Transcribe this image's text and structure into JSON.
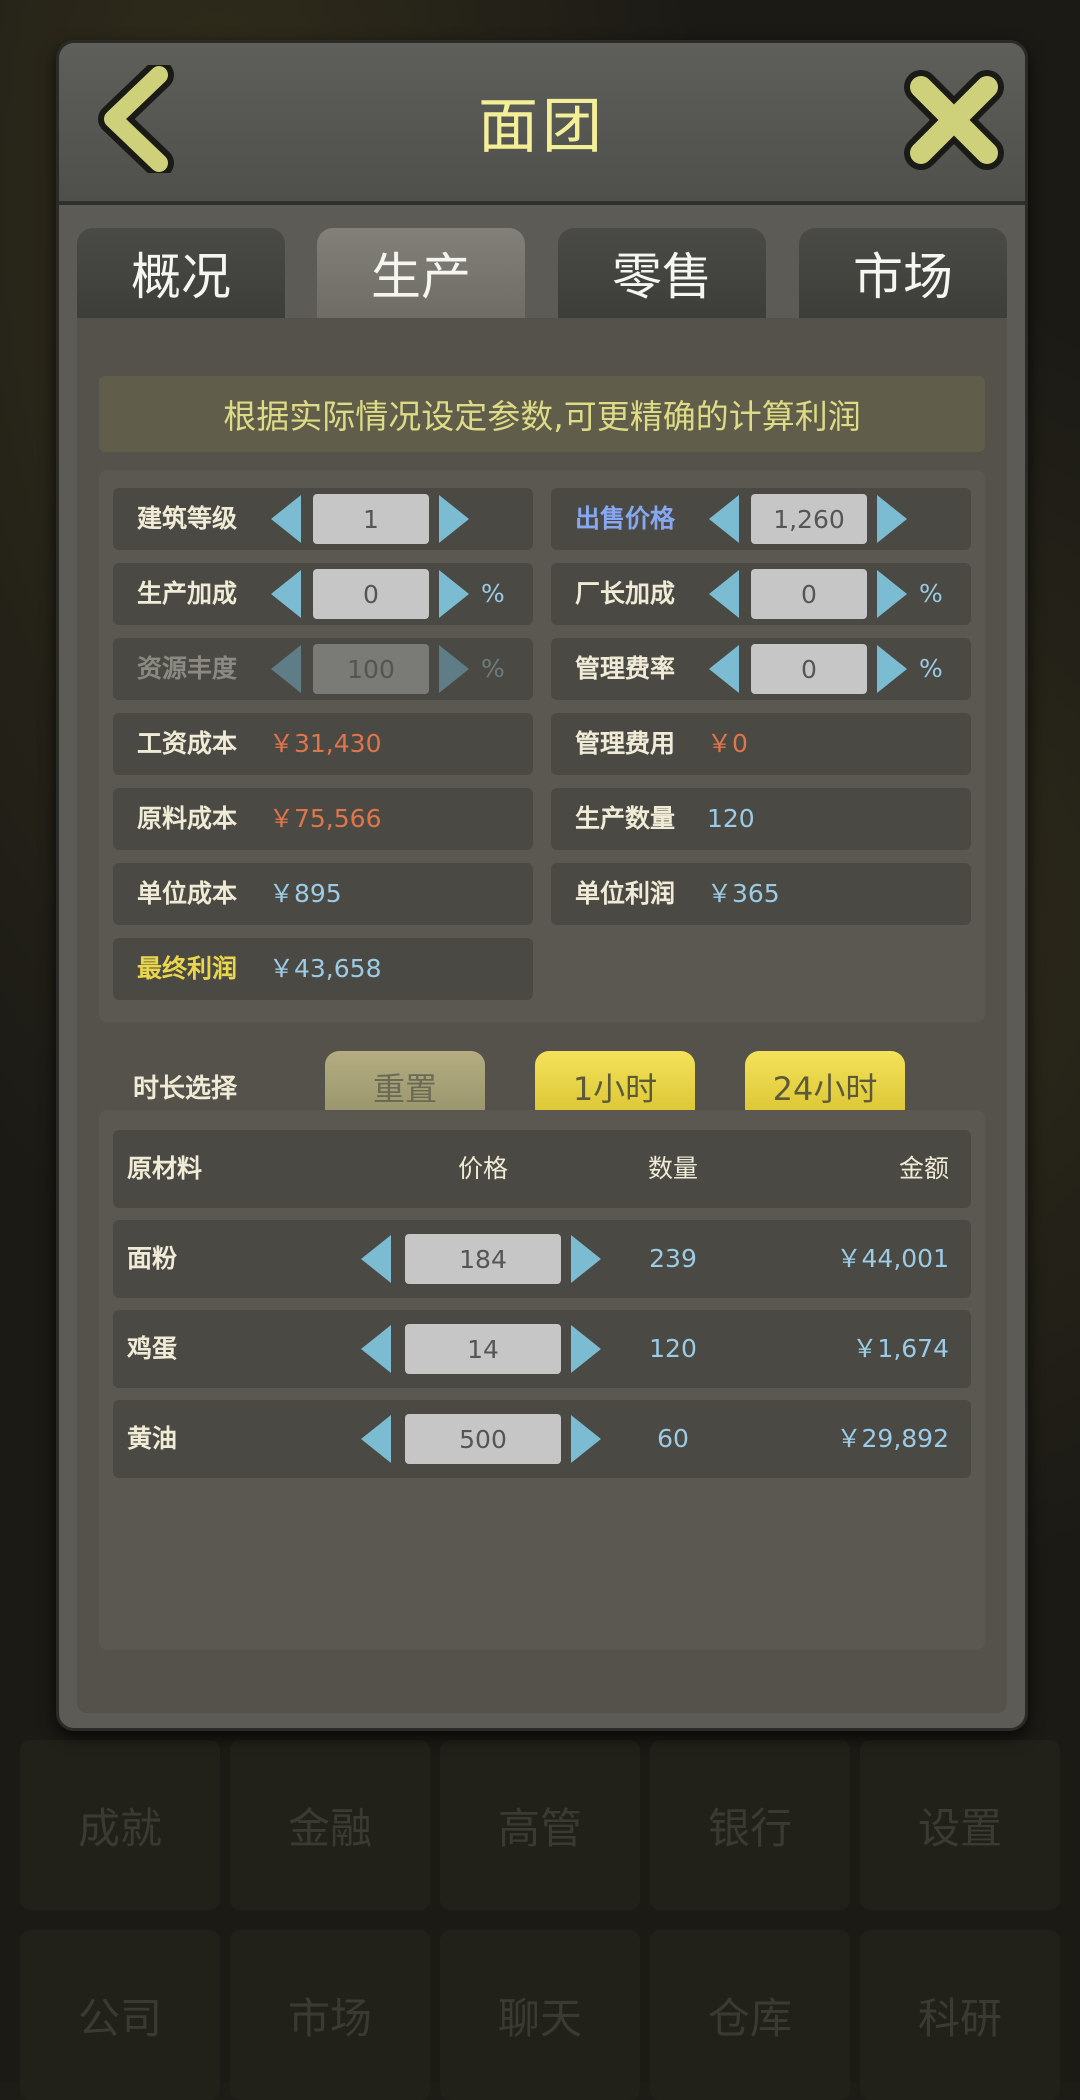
{
  "header": {
    "title": "面团"
  },
  "tabs": [
    {
      "label": "概况"
    },
    {
      "label": "生产"
    },
    {
      "label": "零售"
    },
    {
      "label": "市场"
    }
  ],
  "banner": "根据实际情况设定参数,可更精确的计算利润",
  "params": {
    "building_level": {
      "label": "建筑等级",
      "value": "1"
    },
    "sale_price": {
      "label": "出售价格",
      "value": "1,260"
    },
    "production_bonus": {
      "label": "生产加成",
      "value": "0",
      "unit": "%"
    },
    "manager_bonus": {
      "label": "厂长加成",
      "value": "0",
      "unit": "%"
    },
    "resource_abundance": {
      "label": "资源丰度",
      "value": "100",
      "unit": "%"
    },
    "management_rate": {
      "label": "管理费率",
      "value": "0",
      "unit": "%"
    },
    "wage_cost": {
      "label": "工资成本",
      "value": "￥31,430"
    },
    "management_fee": {
      "label": "管理费用",
      "value": "￥0"
    },
    "material_cost": {
      "label": "原料成本",
      "value": "￥75,566"
    },
    "production_qty": {
      "label": "生产数量",
      "value": "120"
    },
    "unit_cost": {
      "label": "单位成本",
      "value": "￥895"
    },
    "unit_profit": {
      "label": "单位利润",
      "value": "￥365"
    },
    "final_profit": {
      "label": "最终利润",
      "value": "￥43,658"
    }
  },
  "duration": {
    "label": "时长选择",
    "reset": "重置",
    "one_hour": "1小时",
    "day": "24小时"
  },
  "materials": {
    "headers": {
      "name": "原材料",
      "price": "价格",
      "qty": "数量",
      "amount": "金额"
    },
    "rows": [
      {
        "name": "面粉",
        "price": "184",
        "qty": "239",
        "amount": "￥44,001"
      },
      {
        "name": "鸡蛋",
        "price": "14",
        "qty": "120",
        "amount": "￥1,674"
      },
      {
        "name": "黄油",
        "price": "500",
        "qty": "60",
        "amount": "￥29,892"
      }
    ]
  },
  "background_menu": {
    "row1": [
      "成就",
      "金融",
      "高管",
      "银行",
      "设置"
    ],
    "row2": [
      "公司",
      "市场",
      "聊天",
      "仓库",
      "科研"
    ]
  },
  "colors": {
    "title_yellow": "#f3ef97",
    "arrow_blue": "#7cbcd2",
    "value_red": "#e0744b",
    "value_cyan": "#9ccbe6",
    "button_yellow": "#e6d244"
  }
}
